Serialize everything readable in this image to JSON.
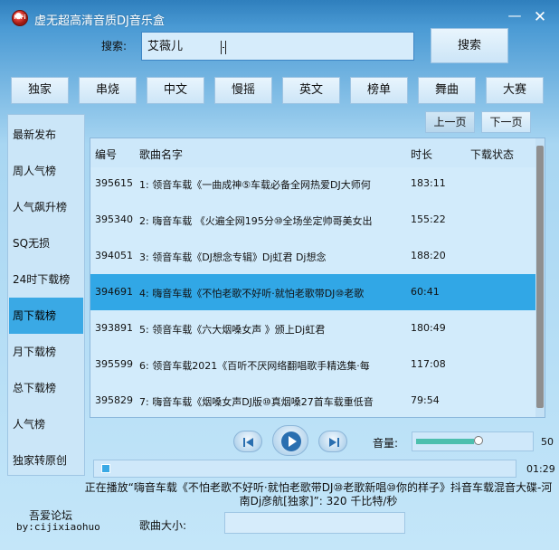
{
  "window": {
    "title": "虚无超高清音质DJ音乐盒",
    "icon_text": "HiFi",
    "minimize_glyph": "—",
    "close_glyph": "✕"
  },
  "search": {
    "label": "搜索:",
    "value": "艾薇儿",
    "button_label": "搜索"
  },
  "categories": [
    "独家",
    "串烧",
    "中文",
    "慢摇",
    "英文",
    "榜单",
    "舞曲",
    "大赛"
  ],
  "sidebar": {
    "items": [
      "最新发布",
      "周人气榜",
      "人气飙升榜",
      "SQ无损",
      "24时下载榜",
      "周下载榜",
      "月下载榜",
      "总下载榜",
      "人气榜",
      "独家转原创"
    ],
    "active_index": 5
  },
  "pager": {
    "prev_label": "上一页",
    "next_label": "下一页"
  },
  "table": {
    "headers": {
      "id": "编号",
      "name": "歌曲名字",
      "duration": "时长",
      "status": "下载状态"
    },
    "rows": [
      {
        "id": "395615",
        "name": "1: 领音车载《一曲成神⑤车载必备全网热爱DJ大师何",
        "duration": "183:11",
        "status": ""
      },
      {
        "id": "395340",
        "name": "2: 嗨音车载 《火遍全网195分⑩全场坐定帅哥美女出",
        "duration": "155:22",
        "status": ""
      },
      {
        "id": "394051",
        "name": "3: 领音车载《DJ想念专辑》Dj虹君 Dj想念",
        "duration": "188:20",
        "status": ""
      },
      {
        "id": "394691",
        "name": "4: 嗨音车载《不怕老歌不好听·就怕老歌带DJ⑩老歌",
        "duration": "60:41",
        "status": ""
      },
      {
        "id": "393891",
        "name": "5: 领音车载《六大烟嗓女声 》颁上Dj虹君",
        "duration": "180:49",
        "status": ""
      },
      {
        "id": "395599",
        "name": "6: 领音车载2021《百听不厌网络翻唱歌手精选集·每",
        "duration": "117:08",
        "status": ""
      },
      {
        "id": "395829",
        "name": "7: 嗨音车载《烟嗓女声DJ版⑩真烟嗓27首车载重低音",
        "duration": "79:54",
        "status": ""
      }
    ],
    "selected_index": 3
  },
  "player": {
    "prev_icon": "skip-previous-icon",
    "play_icon": "play-icon",
    "next_icon": "skip-next-icon",
    "volume_label": "音量:",
    "volume": 50,
    "volume_max": 100,
    "position_fraction": 0.01,
    "time": "01:29",
    "now_playing": "正在播放“嗨音车载《不怕老歌不好听·就怕老歌带DJ⑩老歌新唱⑩你的样子》抖音车载混音大碟-河南Dj彦航[独家]”: 320 千比特/秒"
  },
  "footer": {
    "forum_name": "吾爱论坛",
    "forum_author": "by:cijixiaohuo",
    "size_label": "歌曲大小:",
    "size_value": ""
  },
  "colors": {
    "selection": "#31a7e6",
    "volume_fill": "#4dbfae",
    "title_bar": "#2f7fbd"
  }
}
